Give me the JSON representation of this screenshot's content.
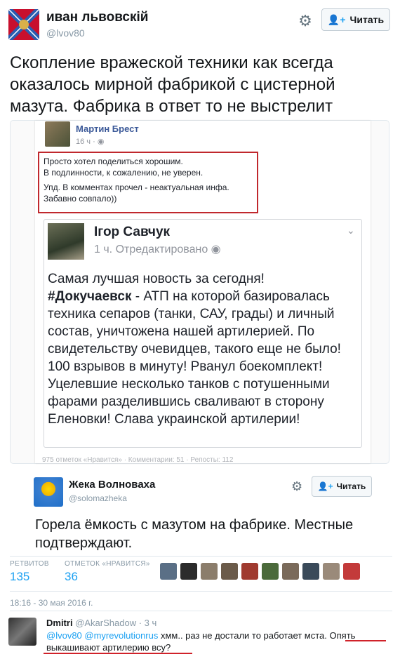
{
  "tweet": {
    "name": "иван львовскiй",
    "handle": "@lvov80",
    "follow_label": "Читать",
    "text": "Скопление вражеской техники как всегда оказалось мирной фабрикой с цистерной мазута. Фабрика в ответ то не выстрелит"
  },
  "fb_post": {
    "author": "Мартин Брест",
    "time": "16 ч · ",
    "lines": [
      "Просто хотел поделиться хорошим.",
      "В подлинности, к сожалению, не уверен.",
      "Упд. В комментах прочел - неактуальная инфа.",
      "Забавно совпало))"
    ],
    "footer": "975 отметок «Нравится» · Комментарии: 51 · Репосты: 112"
  },
  "inner_share": {
    "author": "Ігор Савчук",
    "time": "1 ч. Отредактировано",
    "hashtag": "#Докучаевск",
    "intro": "Самая лучшая новость за сегодня!",
    "body": " - АТП на которой базировалась техника сепаров (танки, САУ, грады) и личный состав, уничтожена нашей артилерией. По свидетельству очевидцев, такого еще не было! 100 взрывов в минуту! Рванул боекомплект! Уцелевшие несколько танков с потушенными фарами разделившись сваливают в сторону Еленовки! Слава украинской артилерии!"
  },
  "quoted": {
    "name": "Жека Волноваха",
    "handle": "@solomazheka",
    "follow_label": "Читать",
    "text": "Горела ёмкость с мазутом на фабрике. Местные подтверждают."
  },
  "stats": {
    "retweets_label": "РЕТВИТОВ",
    "retweets_value": "135",
    "likes_label": "ОТМЕТОК «НРАВИТСЯ»",
    "likes_value": "36"
  },
  "likers_colors": [
    "#5a6f86",
    "#2b2b2b",
    "#8b7d6b",
    "#6b5b4a",
    "#a03a2f",
    "#4b6a3b",
    "#7a6a5a",
    "#3a4a5a",
    "#9a8a7a",
    "#c33a3a"
  ],
  "date": "18:16 - 30 мая 2016 г.",
  "reply": {
    "name": "Dmitri",
    "handle": "@AkarShadow",
    "time": "· 3 ч",
    "mention1": "@lvov80",
    "mention2": "@myrevolutionrus",
    "text_part1": " хмм.. раз не достали то работает мста. ",
    "text_part2": "Опять выкашивают артилерию всу?"
  },
  "colors": {
    "twitter_blue": "#1da1f2",
    "facebook_blue": "#3b5998",
    "highlight_red": "#c0282d"
  }
}
